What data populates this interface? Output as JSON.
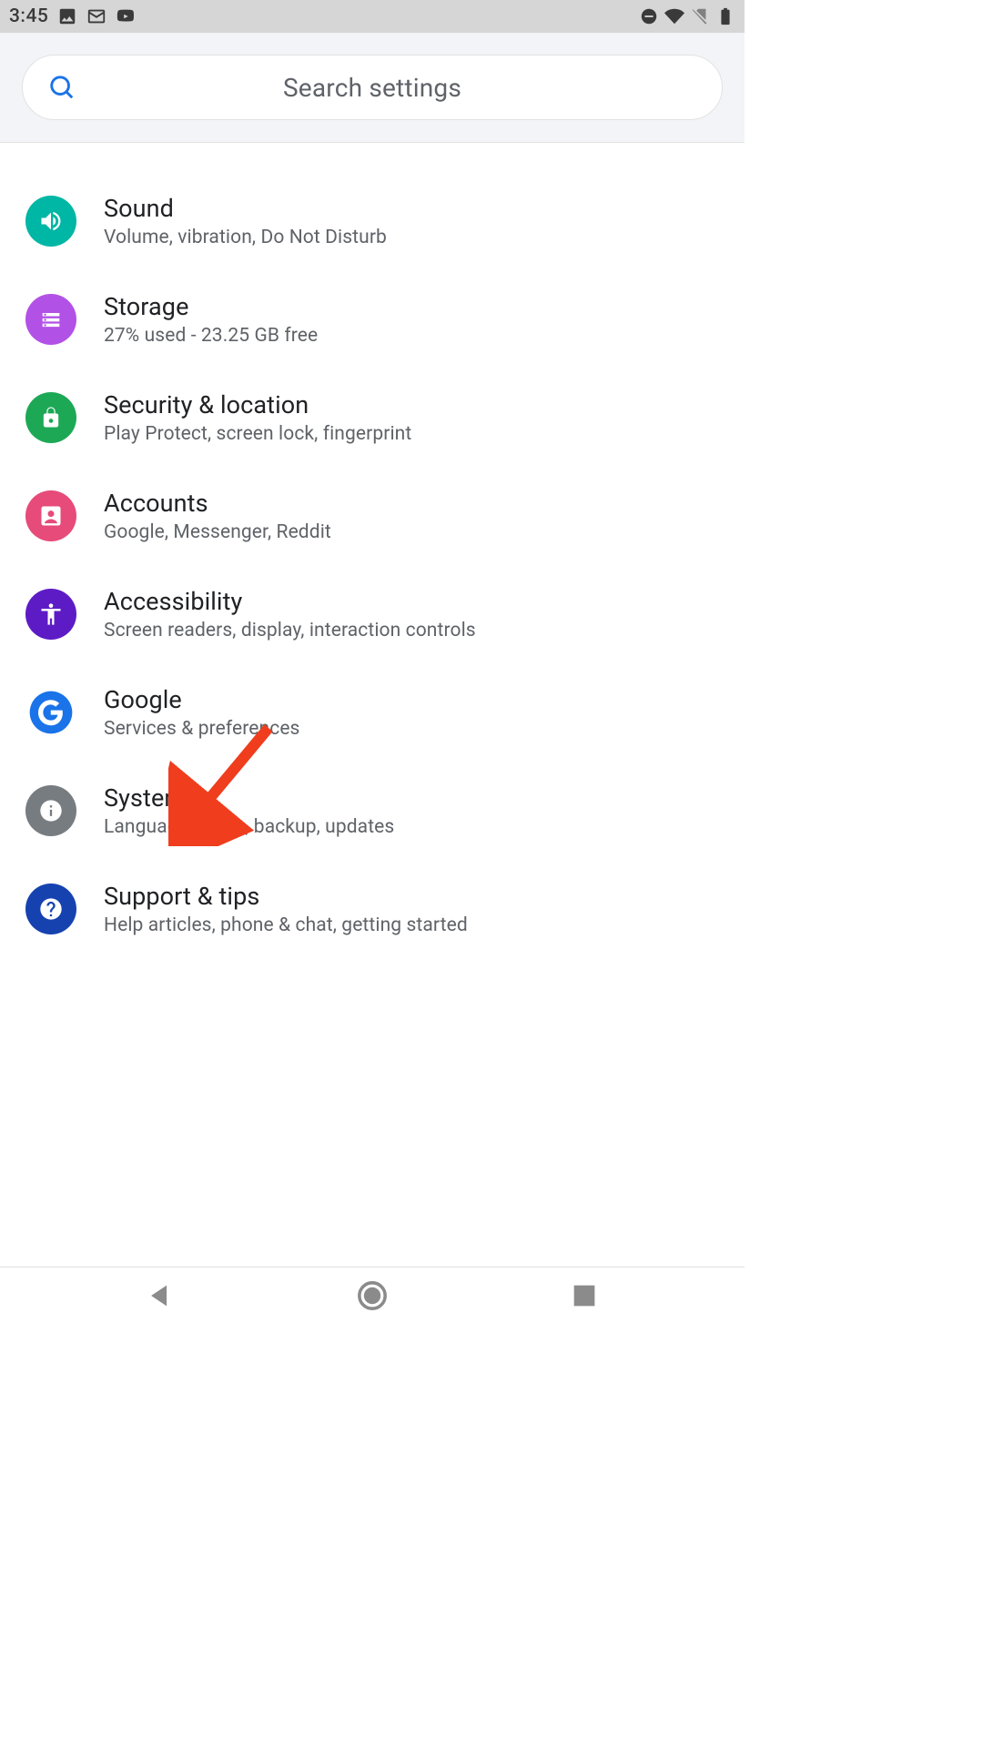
{
  "status": {
    "time": "3:45"
  },
  "search": {
    "placeholder": "Search settings"
  },
  "items": [
    {
      "key": "sound",
      "title": "Sound",
      "sub": "Volume, vibration, Do Not Disturb",
      "bg": "bg-sound",
      "icon": "speaker"
    },
    {
      "key": "storage",
      "title": "Storage",
      "sub": "27% used - 23.25 GB free",
      "bg": "bg-storage",
      "icon": "storage"
    },
    {
      "key": "security",
      "title": "Security & location",
      "sub": "Play Protect, screen lock, fingerprint",
      "bg": "bg-security",
      "icon": "lock"
    },
    {
      "key": "accounts",
      "title": "Accounts",
      "sub": "Google, Messenger, Reddit",
      "bg": "bg-accounts",
      "icon": "person-box"
    },
    {
      "key": "accessibility",
      "title": "Accessibility",
      "sub": "Screen readers, display, interaction controls",
      "bg": "bg-accessibility",
      "icon": "accessibility"
    },
    {
      "key": "google",
      "title": "Google",
      "sub": "Services & preferences",
      "bg": "bg-google",
      "icon": "google"
    },
    {
      "key": "system",
      "title": "System",
      "sub": "Languages, time, backup, updates",
      "bg": "bg-system",
      "icon": "info"
    },
    {
      "key": "support",
      "title": "Support & tips",
      "sub": "Help articles, phone & chat, getting started",
      "bg": "bg-support",
      "icon": "help"
    }
  ],
  "annotation": {
    "arrow_target": "system"
  }
}
